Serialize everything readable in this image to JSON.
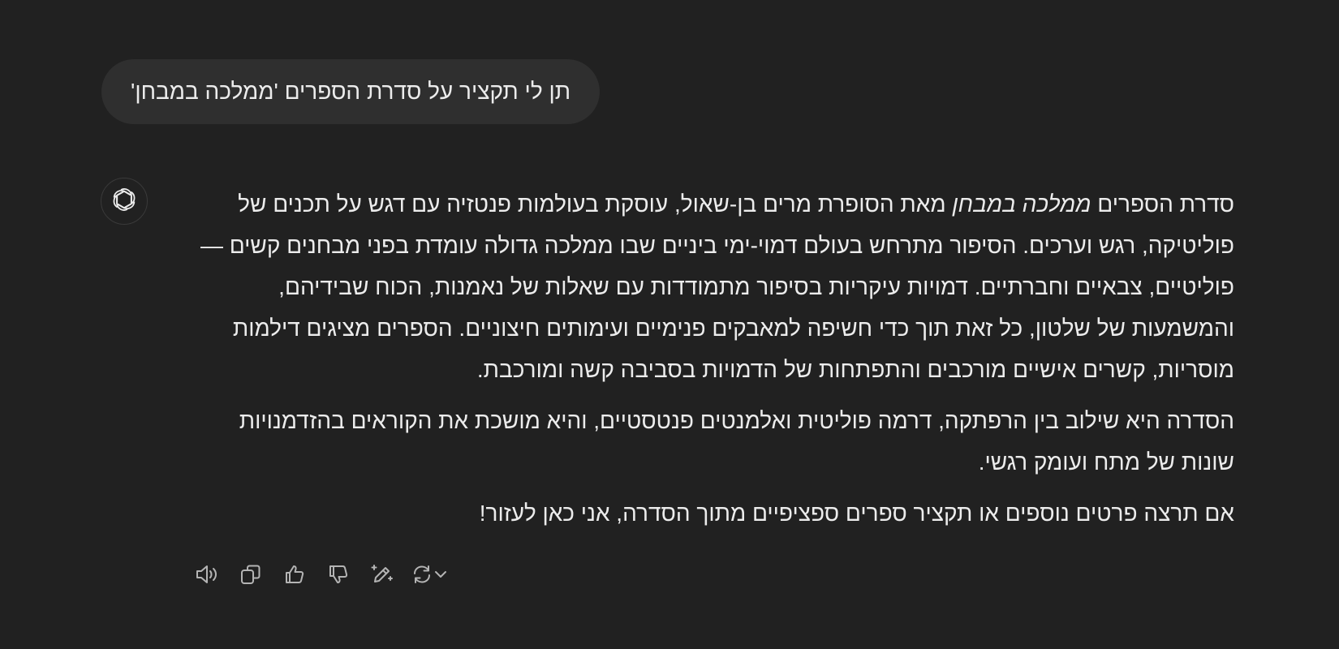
{
  "conversation": {
    "user_message": "תן לי תקציר על סדרת הספרים 'ממלכה במבחן'",
    "assistant": {
      "avatar_icon": "openai-logo-icon",
      "paragraph1": {
        "before_title": "סדרת הספרים ",
        "title": "ממלכה במבחן",
        "after_title": " מאת הסופרת מרים בן-שאול, עוסקת בעולמות פנטזיה עם דגש על תכנים של פוליטיקה, רגש וערכים. הסיפור מתרחש בעולם דמוי-ימי ביניים שבו ממלכה גדולה עומדת בפני מבחנים קשים — פוליטיים, צבאיים וחברתיים. דמויות עיקריות בסיפור מתמודדות עם שאלות של נאמנות, הכוח שבידיהם, והמשמעות של שלטון, כל זאת תוך כדי חשיפה למאבקים פנימיים ועימותים חיצוניים. הספרים מציגים דילמות מוסריות, קשרים אישיים מורכבים והתפתחות של הדמויות בסביבה קשה ומורכבת."
      },
      "paragraph2": "הסדרה היא שילוב בין הרפתקה, דרמה פוליטית ואלמנטים פנטסטיים, והיא מושכת את הקוראים בהזדמנויות שונות של מתח ועומק רגשי.",
      "paragraph3": "אם תרצה פרטים נוספים או תקציר ספרים ספציפיים מתוך הסדרה, אני כאן לעזור!"
    }
  },
  "actions": [
    {
      "name": "read-aloud",
      "icon": "speaker-icon"
    },
    {
      "name": "copy",
      "icon": "copy-icon"
    },
    {
      "name": "good-response",
      "icon": "thumbs-up-icon"
    },
    {
      "name": "bad-response",
      "icon": "thumbs-down-icon"
    },
    {
      "name": "edit-in-canvas",
      "icon": "pen-sparkle-icon"
    },
    {
      "name": "regenerate",
      "icon": "refresh-icon"
    }
  ],
  "colors": {
    "background": "#212121",
    "user_bubble": "#2f2f2f",
    "text": "#ececec",
    "icon": "#b4b4b4"
  }
}
